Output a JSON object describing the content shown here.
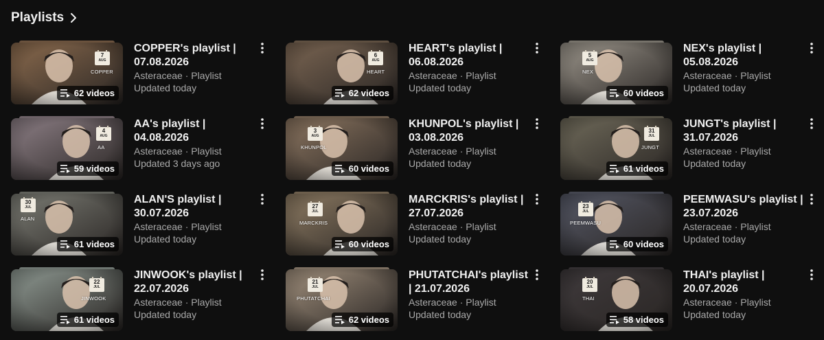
{
  "header": {
    "title": "Playlists"
  },
  "playlists": [
    {
      "title": "COPPER's playlist | 07.08.2026",
      "channel": "Asteraceae",
      "type": "Playlist",
      "separator": "·",
      "updated": "Updated today",
      "video_count": "62 videos",
      "cover": {
        "day": "7",
        "month": "AUG",
        "name": "COPPER",
        "tone": "#8a6a4d"
      }
    },
    {
      "title": "HEART's playlist | 06.08.2026",
      "channel": "Asteraceae",
      "type": "Playlist",
      "separator": "·",
      "updated": "Updated today",
      "video_count": "62 videos",
      "cover": {
        "day": "6",
        "month": "AUG",
        "name": "HEART",
        "tone": "#7a6552"
      }
    },
    {
      "title": "NEX's playlist | 05.08.2026",
      "channel": "Asteraceae",
      "type": "Playlist",
      "separator": "·",
      "updated": "Updated today",
      "video_count": "60 videos",
      "cover": {
        "day": "5",
        "month": "AUG",
        "name": "NEX",
        "tone": "#9a948a"
      }
    },
    {
      "title": "AA's playlist | 04.08.2026",
      "channel": "Asteraceae",
      "type": "Playlist",
      "separator": "·",
      "updated": "Updated 3 days ago",
      "video_count": "59 videos",
      "cover": {
        "day": "4",
        "month": "AUG",
        "name": "AA",
        "tone": "#8d7f86"
      }
    },
    {
      "title": "KHUNPOL's playlist | 03.08.2026",
      "channel": "Asteraceae",
      "type": "Playlist",
      "separator": "·",
      "updated": "Updated today",
      "video_count": "60 videos",
      "cover": {
        "day": "3",
        "month": "AUG",
        "name": "KHUNPOL",
        "tone": "#8b7560"
      }
    },
    {
      "title": "JUNGT's playlist | 31.07.2026",
      "channel": "Asteraceae",
      "type": "Playlist",
      "separator": "·",
      "updated": "Updated today",
      "video_count": "61 videos",
      "cover": {
        "day": "31",
        "month": "JUL",
        "name": "JUNGT",
        "tone": "#6f6a5a"
      }
    },
    {
      "title": "ALAN'S playlist | 30.07.2026",
      "channel": "Asteraceae",
      "type": "Playlist",
      "separator": "·",
      "updated": "Updated today",
      "video_count": "61 videos",
      "cover": {
        "day": "30",
        "month": "JUL",
        "name": "ALAN",
        "tone": "#7b7c74"
      }
    },
    {
      "title": "MARCKRIS's playlist | 27.07.2026",
      "channel": "Asteraceae",
      "type": "Playlist",
      "separator": "·",
      "updated": "Updated today",
      "video_count": "60 videos",
      "cover": {
        "day": "27",
        "month": "JUL",
        "name": "MARCKRIS",
        "tone": "#8c7a62"
      }
    },
    {
      "title": "PEEMWASU's playlist | 23.07.2026",
      "channel": "Asteraceae",
      "type": "Playlist",
      "separator": "·",
      "updated": "Updated today",
      "video_count": "60 videos",
      "cover": {
        "day": "23",
        "month": "JUL",
        "name": "PEEMWASU",
        "tone": "#555866"
      }
    },
    {
      "title": "JINWOOK's playlist | 22.07.2026",
      "channel": "Asteraceae",
      "type": "Playlist",
      "separator": "·",
      "updated": "Updated today",
      "video_count": "61 videos",
      "cover": {
        "day": "22",
        "month": "JUL",
        "name": "JINWOOK",
        "tone": "#8f9a93"
      }
    },
    {
      "title": "PHUTATCHAI's playlist | 21.07.2026",
      "channel": "Asteraceae",
      "type": "Playlist",
      "separator": "·",
      "updated": "Updated today",
      "video_count": "62 videos",
      "cover": {
        "day": "21",
        "month": "JUL",
        "name": "PHUTATCHAI",
        "tone": "#a08f7c"
      }
    },
    {
      "title": "THAI's playlist | 20.07.2026",
      "channel": "Asteraceae",
      "type": "Playlist",
      "separator": "·",
      "updated": "Updated today",
      "video_count": "58 videos",
      "cover": {
        "day": "20",
        "month": "JUL",
        "name": "THAI",
        "tone": "#3f3a3c"
      }
    }
  ]
}
